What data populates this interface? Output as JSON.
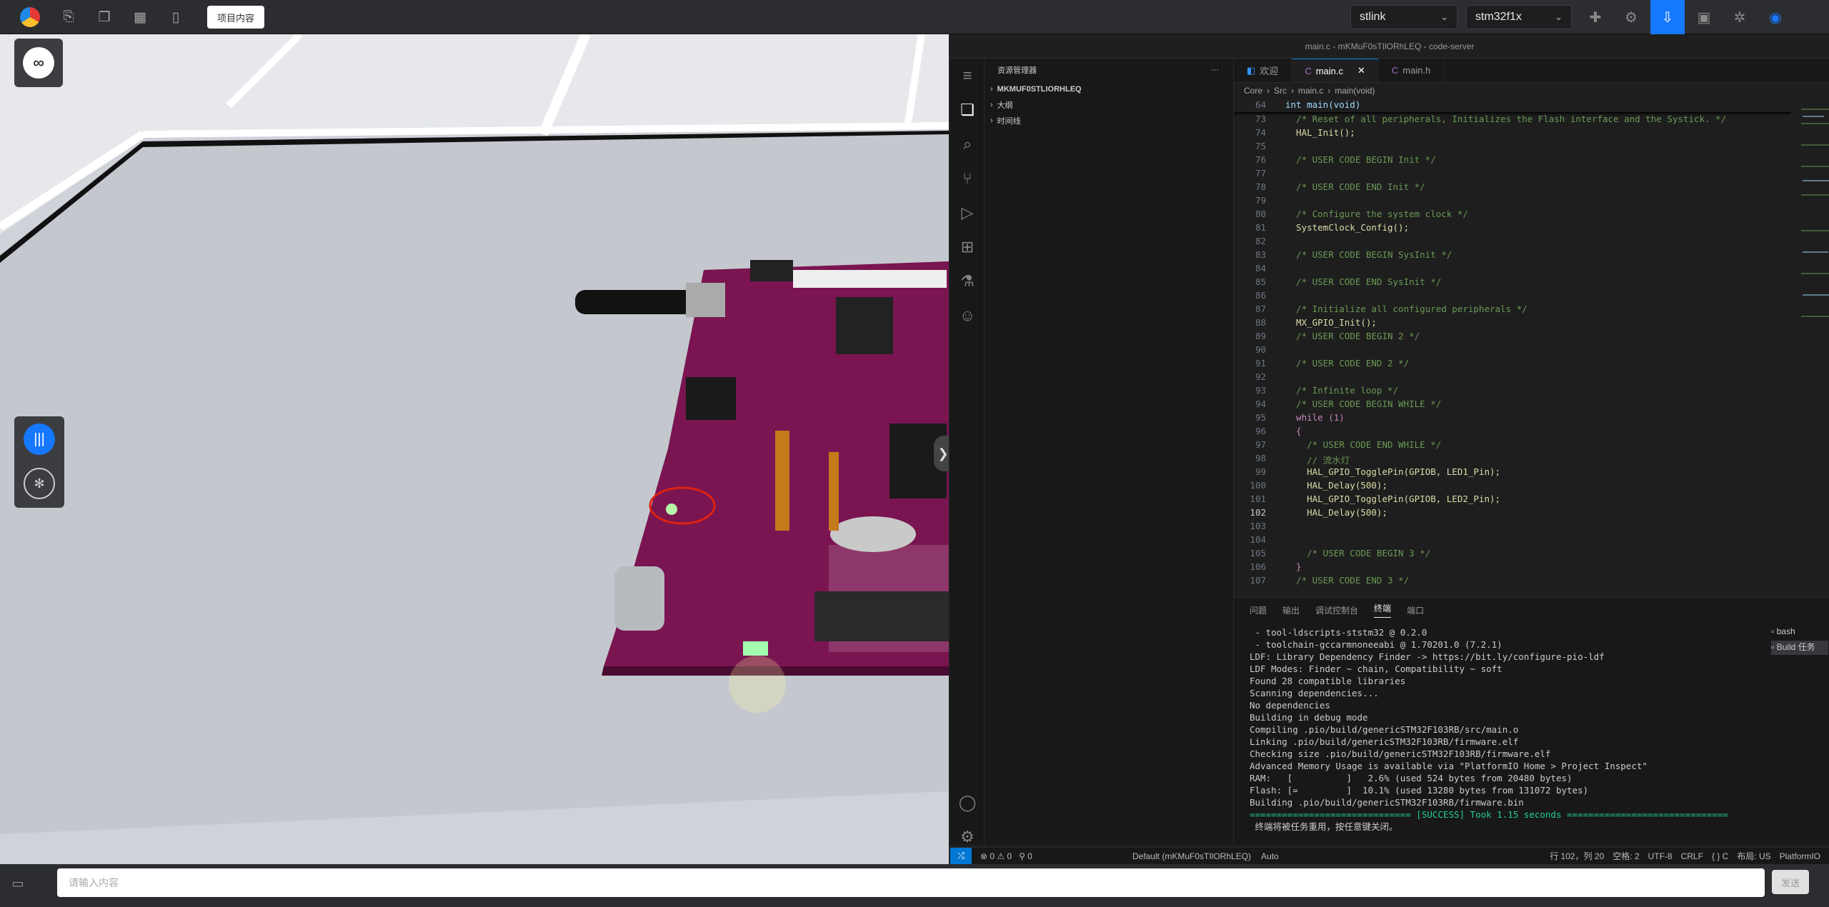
{
  "topbar": {
    "project_button": "项目内容",
    "programmer_select": "stlink",
    "chip_select": "stm32f1x"
  },
  "vscode": {
    "title": "main.c - mKMuF0sTIlORhLEQ - code-server",
    "explorer_title": "资源管理器",
    "tree": [
      "MKMUF0STLIORHLEQ",
      "大纲",
      "时间线"
    ],
    "tabs": [
      {
        "label": "欢迎"
      },
      {
        "label": "main.c"
      },
      {
        "label": "main.h"
      }
    ],
    "breadcrumb": [
      "Core",
      "Src",
      "main.c",
      "main(void)"
    ],
    "sticky": {
      "num": "64",
      "text": "int main(void)"
    },
    "code": [
      [
        "73",
        "  /* Reset of all peripherals, Initializes the Flash interface and the Systick. */"
      ],
      [
        "74",
        "  HAL_Init();"
      ],
      [
        "75",
        ""
      ],
      [
        "76",
        "  /* USER CODE BEGIN Init */"
      ],
      [
        "77",
        ""
      ],
      [
        "78",
        "  /* USER CODE END Init */"
      ],
      [
        "79",
        ""
      ],
      [
        "80",
        "  /* Configure the system clock */"
      ],
      [
        "81",
        "  SystemClock_Config();"
      ],
      [
        "82",
        ""
      ],
      [
        "83",
        "  /* USER CODE BEGIN SysInit */"
      ],
      [
        "84",
        ""
      ],
      [
        "85",
        "  /* USER CODE END SysInit */"
      ],
      [
        "86",
        ""
      ],
      [
        "87",
        "  /* Initialize all configured peripherals */"
      ],
      [
        "88",
        "  MX_GPIO_Init();"
      ],
      [
        "89",
        "  /* USER CODE BEGIN 2 */"
      ],
      [
        "90",
        ""
      ],
      [
        "91",
        "  /* USER CODE END 2 */"
      ],
      [
        "92",
        ""
      ],
      [
        "93",
        "  /* Infinite loop */"
      ],
      [
        "94",
        "  /* USER CODE BEGIN WHILE */"
      ],
      [
        "95",
        "  while (1)"
      ],
      [
        "96",
        "  {"
      ],
      [
        "97",
        "    /* USER CODE END WHILE */"
      ],
      [
        "98",
        "    // 流水灯"
      ],
      [
        "99",
        "    HAL_GPIO_TogglePin(GPIOB, LED1_Pin);"
      ],
      [
        "100",
        "    HAL_Delay(500);"
      ],
      [
        "101",
        "    HAL_GPIO_TogglePin(GPIOB, LED2_Pin);"
      ],
      [
        "102",
        "    HAL_Delay(500);"
      ],
      [
        "103",
        ""
      ],
      [
        "104",
        ""
      ],
      [
        "105",
        "    /* USER CODE BEGIN 3 */"
      ],
      [
        "106",
        "  }"
      ],
      [
        "107",
        "  /* USER CODE END 3 */"
      ]
    ],
    "panel_tabs": [
      "问题",
      "输出",
      "调试控制台",
      "终端",
      "端口"
    ],
    "terminal_lines": [
      " - tool-ldscripts-ststm32 @ 0.2.0",
      " - toolchain-gccarmnoneeabi @ 1.70201.0 (7.2.1)",
      "LDF: Library Dependency Finder -> https://bit.ly/configure-pio-ldf",
      "LDF Modes: Finder ~ chain, Compatibility ~ soft",
      "Found 28 compatible libraries",
      "Scanning dependencies...",
      "No dependencies",
      "Building in debug mode",
      "Compiling .pio/build/genericSTM32F103RB/src/main.o",
      "Linking .pio/build/genericSTM32F103RB/firmware.elf",
      "Checking size .pio/build/genericSTM32F103RB/firmware.elf",
      "Advanced Memory Usage is available via \"PlatformIO Home > Project Inspect\"",
      "RAM:   [          ]   2.6% (used 524 bytes from 20480 bytes)",
      "Flash: [=         ]  10.1% (used 13280 bytes from 131072 bytes)",
      "Building .pio/build/genericSTM32F103RB/firmware.bin"
    ],
    "terminal_success": "============================== [SUCCESS] Took 1.15 seconds ==============================",
    "terminal_last": " 终端将被任务重用，按任意键关闭。",
    "terminal_tabs": [
      "bash",
      "Build 任务"
    ],
    "status": {
      "problems": "⊗ 0 ⚠ 0",
      "ports": "0",
      "profile": "Default (mKMuF0sTIlORhLEQ)",
      "auto": "Auto",
      "position": "行 102，列 20",
      "spaces": "空格: 2",
      "encoding": "UTF-8",
      "eol": "CRLF",
      "lang": "{ } C",
      "layout": "布局: US",
      "platform": "PlatformIO"
    }
  },
  "bottom": {
    "placeholder": "请输入内容",
    "send": "发送"
  },
  "colors": {
    "accent": "#1677ff",
    "board": "#7a1551"
  }
}
